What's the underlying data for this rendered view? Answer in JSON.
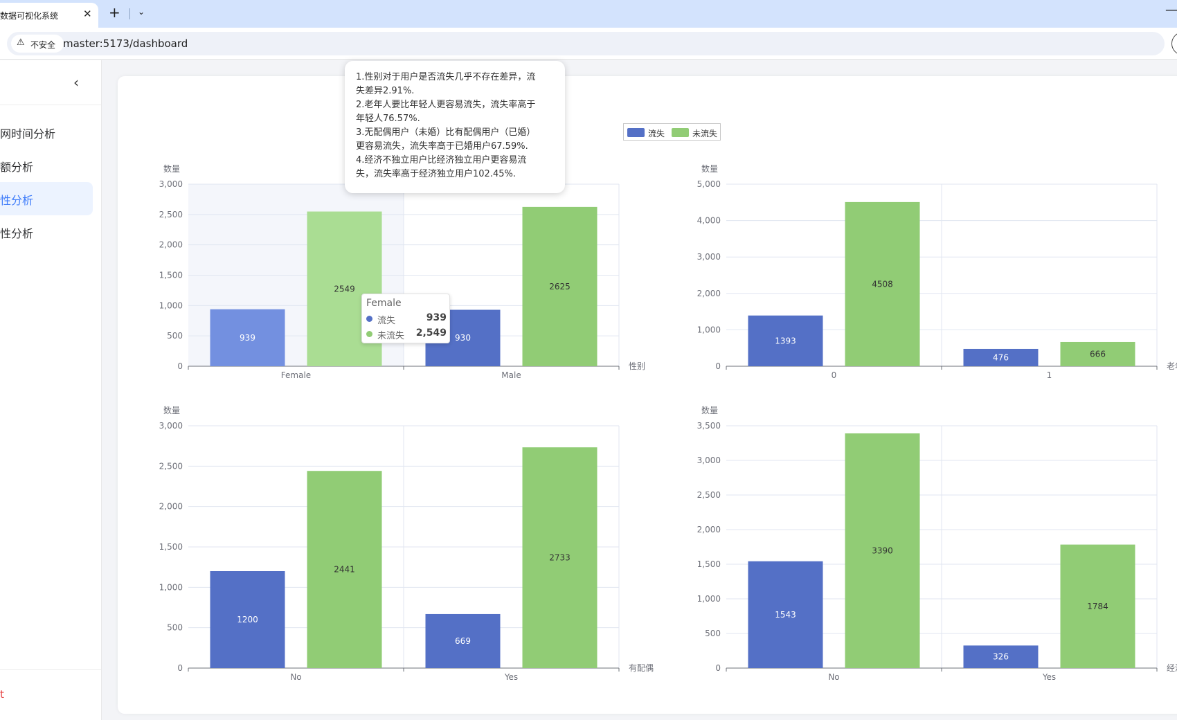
{
  "browser": {
    "tab_title": "数据可视化系统",
    "url": "master:5173/dashboard",
    "security_label": "不安全"
  },
  "sidebar": {
    "items": [
      {
        "label": "网时间分析"
      },
      {
        "label": "额分析"
      },
      {
        "label": "性分析"
      },
      {
        "label": "性分析"
      }
    ],
    "active_index": 2,
    "footer_label": "t"
  },
  "analysis_notes": [
    "1.性别对于用户是否流失几乎不存在差异，流",
    "失差异2.91%.",
    "2.老年人要比年轻人更容易流失，流失率高于",
    "年轻人76.57%.",
    "3.无配偶用户（未婚）比有配偶用户（已婚）",
    "更容易流失，流失率高于已婚用户67.59%.",
    "4.经济不独立用户比经济独立用户更容易流",
    "失，流失率高于经济独立用户102.45%."
  ],
  "legend": [
    {
      "name": "流失",
      "color": "#5470c6"
    },
    {
      "name": "未流失",
      "color": "#91cc75"
    }
  ],
  "tooltip": {
    "title": "Female",
    "rows": [
      {
        "name": "流失",
        "value": "939",
        "color": "#5470c6"
      },
      {
        "name": "未流失",
        "value": "2,549",
        "color": "#91cc75"
      }
    ]
  },
  "chart_data": [
    {
      "type": "bar",
      "ylabel": "数量",
      "xlabel": "性别",
      "categories": [
        "Female",
        "Male"
      ],
      "series": [
        {
          "name": "流失",
          "values": [
            939,
            930
          ]
        },
        {
          "name": "未流失",
          "values": [
            2549,
            2625
          ]
        }
      ],
      "ylim": [
        0,
        3000
      ],
      "yticks": [
        0,
        500,
        1000,
        1500,
        2000,
        2500,
        3000
      ],
      "ytick_labels": [
        "0",
        "500",
        "1,000",
        "1,500",
        "2,000",
        "2,500",
        "3,000"
      ],
      "highlight_index": 0
    },
    {
      "type": "bar",
      "ylabel": "数量",
      "xlabel": "老年",
      "categories": [
        "0",
        "1"
      ],
      "series": [
        {
          "name": "流失",
          "values": [
            1393,
            476
          ]
        },
        {
          "name": "未流失",
          "values": [
            4508,
            666
          ]
        }
      ],
      "ylim": [
        0,
        5000
      ],
      "yticks": [
        0,
        1000,
        2000,
        3000,
        4000,
        5000
      ],
      "ytick_labels": [
        "0",
        "1,000",
        "2,000",
        "3,000",
        "4,000",
        "5,000"
      ]
    },
    {
      "type": "bar",
      "ylabel": "数量",
      "xlabel": "有配偶",
      "categories": [
        "No",
        "Yes"
      ],
      "series": [
        {
          "name": "流失",
          "values": [
            1200,
            669
          ]
        },
        {
          "name": "未流失",
          "values": [
            2441,
            2733
          ]
        }
      ],
      "ylim": [
        0,
        3000
      ],
      "yticks": [
        0,
        500,
        1000,
        1500,
        2000,
        2500,
        3000
      ],
      "ytick_labels": [
        "0",
        "500",
        "1,000",
        "1,500",
        "2,000",
        "2,500",
        "3,000"
      ]
    },
    {
      "type": "bar",
      "ylabel": "数量",
      "xlabel": "经济",
      "categories": [
        "No",
        "Yes"
      ],
      "series": [
        {
          "name": "流失",
          "values": [
            1543,
            326
          ]
        },
        {
          "name": "未流失",
          "values": [
            3390,
            1784
          ]
        }
      ],
      "ylim": [
        0,
        3500
      ],
      "yticks": [
        0,
        500,
        1000,
        1500,
        2000,
        2500,
        3000,
        3500
      ],
      "ytick_labels": [
        "0",
        "500",
        "1,000",
        "1,500",
        "2,000",
        "2,500",
        "3,000",
        "3,500"
      ]
    }
  ]
}
